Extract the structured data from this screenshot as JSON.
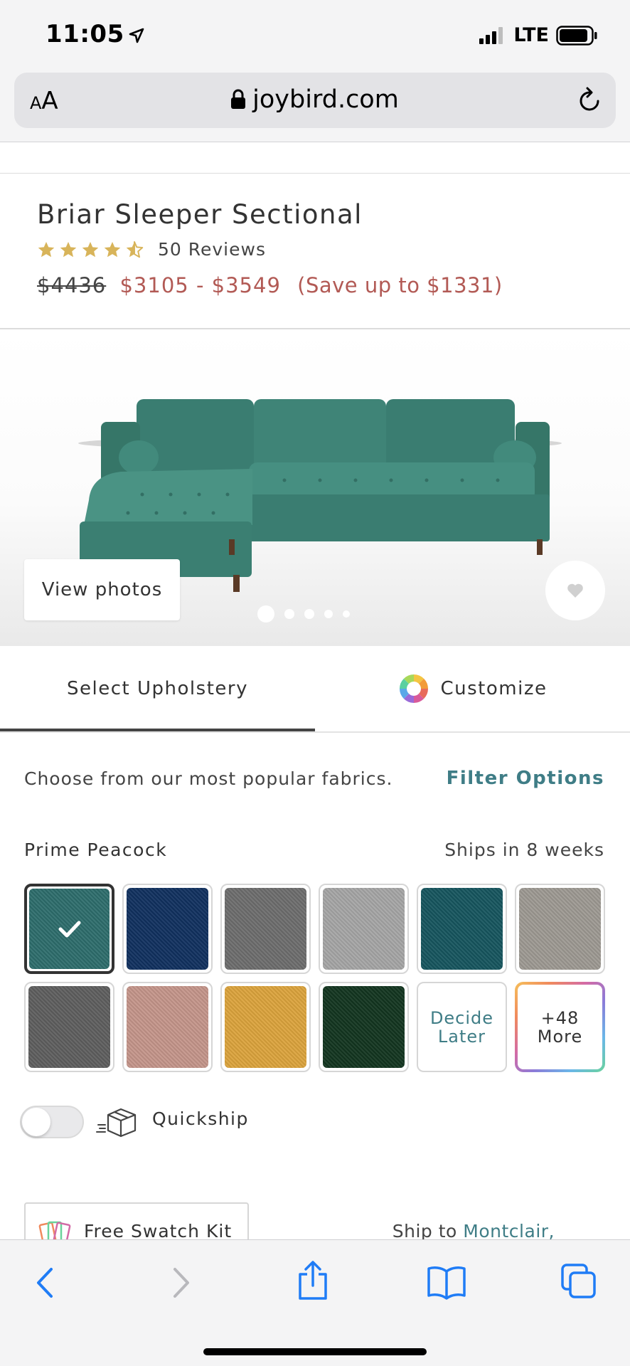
{
  "status_bar": {
    "time": "11:05",
    "network": "LTE"
  },
  "browser": {
    "text_size_small": "A",
    "text_size_big": "A",
    "domain": "joybird.com"
  },
  "product": {
    "title": "Briar Sleeper Sectional",
    "rating": 4.5,
    "rating_max": 5,
    "reviews": "50 Reviews",
    "old_price": "$4436",
    "price_range": "$3105 - $3549",
    "savings": "(Save up to $1331)"
  },
  "gallery": {
    "view_photos_label": "View photos",
    "total_images": 5,
    "active_image": 1,
    "sofa_color": "#3f8477"
  },
  "tabs": {
    "upholstery": "Select Upholstery",
    "customize": "Customize",
    "active": "upholstery"
  },
  "fabrics": {
    "intro": "Choose from our most popular fabrics.",
    "filter_label": "Filter Options",
    "selected_name": "Prime Peacock",
    "ship_time": "Ships in 8 weeks",
    "swatches": [
      {
        "color": "#2d6d6c",
        "selected": true
      },
      {
        "color": "#10305f"
      },
      {
        "color": "#6d6d6d"
      },
      {
        "color": "#a5a5a5"
      },
      {
        "color": "#16555e"
      },
      {
        "color": "#9d9992"
      },
      {
        "color": "#5e5e5e"
      },
      {
        "color": "#c4958a"
      },
      {
        "color": "#dba33c"
      },
      {
        "color": "#12351f"
      }
    ],
    "decide_later_line1": "Decide",
    "decide_later_line2": "Later",
    "more_line1": "+48",
    "more_line2": "More"
  },
  "quickship": {
    "label": "Quickship",
    "enabled": false
  },
  "swatch_kit": {
    "label": "Free Swatch Kit"
  },
  "shipping": {
    "prefix": "Ship to",
    "city": "Montclair,"
  },
  "colors": {
    "accent": "#3f7d86",
    "sale": "#b25a55",
    "star": "#d8b45a",
    "ios_blue": "#1f7cf6"
  }
}
